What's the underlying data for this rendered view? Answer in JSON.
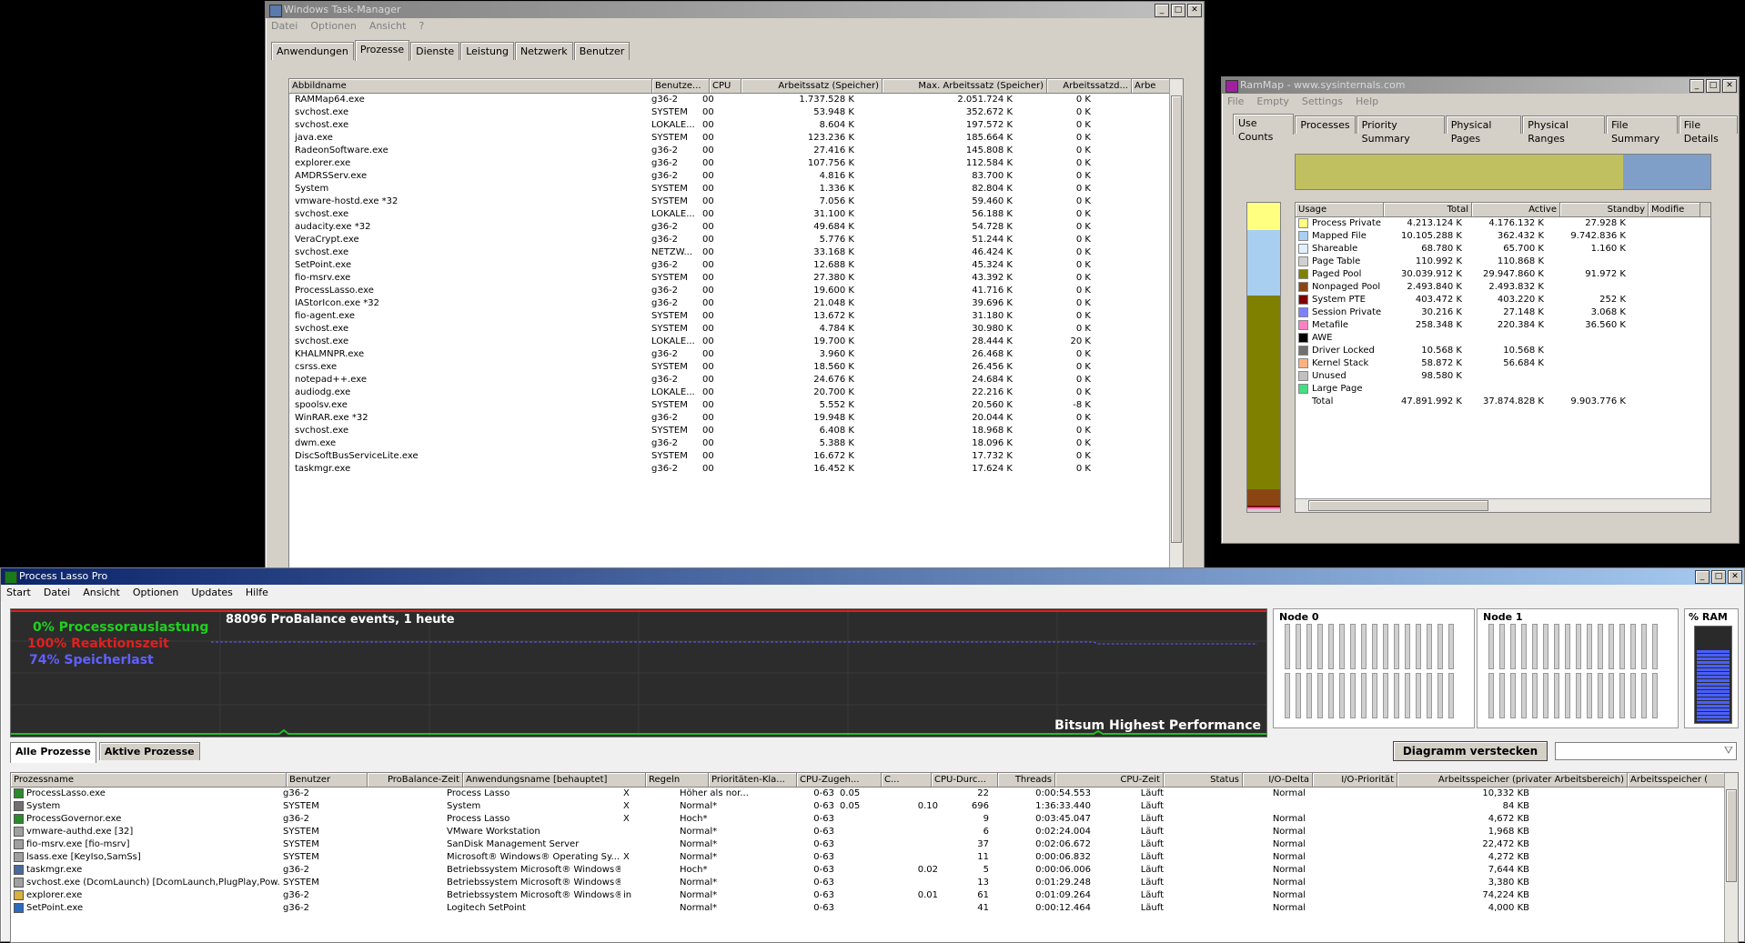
{
  "taskmgr": {
    "title": "Windows Task-Manager",
    "menu": [
      "Datei",
      "Optionen",
      "Ansicht",
      "?"
    ],
    "tabs": [
      "Anwendungen",
      "Prozesse",
      "Dienste",
      "Leistung",
      "Netzwerk",
      "Benutzer"
    ],
    "active_tab": "Prozesse",
    "columns": [
      "Abbildname",
      "Benutze...",
      "CPU",
      "Arbeitssatz (Speicher)",
      "Max. Arbeitssatz (Speicher)",
      "Arbeitssatzd...",
      "Arbe"
    ],
    "rows": [
      [
        "RAMMap64.exe",
        "g36-2",
        "00",
        "1.737.528 K",
        "2.051.724 K",
        "0 K"
      ],
      [
        "svchost.exe",
        "SYSTEM",
        "00",
        "53.948 K",
        "352.672 K",
        "0 K"
      ],
      [
        "svchost.exe",
        "LOKALE...",
        "00",
        "8.604 K",
        "197.572 K",
        "0 K"
      ],
      [
        "java.exe",
        "SYSTEM",
        "00",
        "123.236 K",
        "185.664 K",
        "0 K"
      ],
      [
        "RadeonSoftware.exe",
        "g36-2",
        "00",
        "27.416 K",
        "145.808 K",
        "0 K"
      ],
      [
        "explorer.exe",
        "g36-2",
        "00",
        "107.756 K",
        "112.584 K",
        "0 K"
      ],
      [
        "AMDRSServ.exe",
        "g36-2",
        "00",
        "4.816 K",
        "83.700 K",
        "0 K"
      ],
      [
        "System",
        "SYSTEM",
        "00",
        "1.336 K",
        "82.804 K",
        "0 K"
      ],
      [
        "vmware-hostd.exe *32",
        "SYSTEM",
        "00",
        "7.056 K",
        "59.460 K",
        "0 K"
      ],
      [
        "svchost.exe",
        "LOKALE...",
        "00",
        "31.100 K",
        "56.188 K",
        "0 K"
      ],
      [
        "audacity.exe *32",
        "g36-2",
        "00",
        "49.684 K",
        "54.728 K",
        "0 K"
      ],
      [
        "VeraCrypt.exe",
        "g36-2",
        "00",
        "5.776 K",
        "51.244 K",
        "0 K"
      ],
      [
        "svchost.exe",
        "NETZW...",
        "00",
        "33.168 K",
        "46.424 K",
        "0 K"
      ],
      [
        "SetPoint.exe",
        "g36-2",
        "00",
        "12.688 K",
        "45.324 K",
        "0 K"
      ],
      [
        "fio-msrv.exe",
        "SYSTEM",
        "00",
        "27.380 K",
        "43.392 K",
        "0 K"
      ],
      [
        "ProcessLasso.exe",
        "g36-2",
        "00",
        "19.600 K",
        "41.716 K",
        "0 K"
      ],
      [
        "IAStorIcon.exe *32",
        "g36-2",
        "00",
        "21.048 K",
        "39.696 K",
        "0 K"
      ],
      [
        "fio-agent.exe",
        "SYSTEM",
        "00",
        "13.672 K",
        "31.180 K",
        "0 K"
      ],
      [
        "svchost.exe",
        "SYSTEM",
        "00",
        "4.784 K",
        "30.980 K",
        "0 K"
      ],
      [
        "svchost.exe",
        "LOKALE...",
        "00",
        "19.700 K",
        "28.444 K",
        "20 K"
      ],
      [
        "KHALMNPR.exe",
        "g36-2",
        "00",
        "3.960 K",
        "26.468 K",
        "0 K"
      ],
      [
        "csrss.exe",
        "SYSTEM",
        "00",
        "18.560 K",
        "26.456 K",
        "0 K"
      ],
      [
        "notepad++.exe",
        "g36-2",
        "00",
        "24.676 K",
        "24.684 K",
        "0 K"
      ],
      [
        "audiodg.exe",
        "LOKALE...",
        "00",
        "20.700 K",
        "22.216 K",
        "0 K"
      ],
      [
        "spoolsv.exe",
        "SYSTEM",
        "00",
        "5.552 K",
        "20.560 K",
        "-8 K"
      ],
      [
        "WinRAR.exe *32",
        "g36-2",
        "00",
        "19.948 K",
        "20.044 K",
        "0 K"
      ],
      [
        "svchost.exe",
        "SYSTEM",
        "00",
        "6.408 K",
        "18.968 K",
        "0 K"
      ],
      [
        "dwm.exe",
        "g36-2",
        "00",
        "5.388 K",
        "18.096 K",
        "0 K"
      ],
      [
        "DiscSoftBusServiceLite.exe",
        "SYSTEM",
        "00",
        "16.672 K",
        "17.732 K",
        "0 K"
      ],
      [
        "taskmgr.exe",
        "g36-2",
        "00",
        "16.452 K",
        "17.624 K",
        "0 K"
      ]
    ]
  },
  "rammap": {
    "title": "RamMap - www.sysinternals.com",
    "menu": [
      "File",
      "Empty",
      "Settings",
      "Help"
    ],
    "tabs": [
      "Use Counts",
      "Processes",
      "Priority Summary",
      "Physical Pages",
      "Physical Ranges",
      "File Summary",
      "File Details"
    ],
    "active_tab": "Use Counts",
    "columns": [
      "Usage",
      "Total",
      "Active",
      "Standby",
      "Modifie"
    ],
    "rows": [
      {
        "usage": "Process Private",
        "color": "#ffff80",
        "total": "4.213.124 K",
        "active": "4.176.132 K",
        "standby": "27.928 K"
      },
      {
        "usage": "Mapped File",
        "color": "#a8cff0",
        "total": "10.105.288 K",
        "active": "362.432 K",
        "standby": "9.742.836 K"
      },
      {
        "usage": "Shareable",
        "color": "#e0f0ff",
        "total": "68.780 K",
        "active": "65.700 K",
        "standby": "1.160 K"
      },
      {
        "usage": "Page Table",
        "color": "#d0d0d0",
        "total": "110.992 K",
        "active": "110.868 K",
        "standby": ""
      },
      {
        "usage": "Paged Pool",
        "color": "#808000",
        "total": "30.039.912 K",
        "active": "29.947.860 K",
        "standby": "91.972 K"
      },
      {
        "usage": "Nonpaged Pool",
        "color": "#8b4513",
        "total": "2.493.840 K",
        "active": "2.493.832 K",
        "standby": ""
      },
      {
        "usage": "System PTE",
        "color": "#800000",
        "total": "403.472 K",
        "active": "403.220 K",
        "standby": "252 K"
      },
      {
        "usage": "Session Private",
        "color": "#8080ff",
        "total": "30.216 K",
        "active": "27.148 K",
        "standby": "3.068 K"
      },
      {
        "usage": "Metafile",
        "color": "#ff80c0",
        "total": "258.348 K",
        "active": "220.384 K",
        "standby": "36.560 K"
      },
      {
        "usage": "AWE",
        "color": "#000000",
        "total": "",
        "active": "",
        "standby": ""
      },
      {
        "usage": "Driver Locked",
        "color": "#707070",
        "total": "10.568 K",
        "active": "10.568 K",
        "standby": ""
      },
      {
        "usage": "Kernel Stack",
        "color": "#ffb080",
        "total": "58.872 K",
        "active": "56.684 K",
        "standby": ""
      },
      {
        "usage": "Unused",
        "color": "#c0c0c0",
        "total": "98.580 K",
        "active": "",
        "standby": ""
      },
      {
        "usage": "Large Page",
        "color": "#40e080",
        "total": "",
        "active": "",
        "standby": ""
      },
      {
        "usage": "Total",
        "color": "",
        "total": "47.891.992 K",
        "active": "37.874.828 K",
        "standby": "9.903.776 K"
      }
    ],
    "overview_bar": {
      "active_fraction": 0.79,
      "active_color": "#c0c060",
      "standby_color": "#7f9fc8"
    },
    "vertical_bar": [
      {
        "color": "#ffff80",
        "fraction": 0.088
      },
      {
        "color": "#a8cff0",
        "fraction": 0.211
      },
      {
        "color": "#808000",
        "fraction": 0.627
      },
      {
        "color": "#8b4513",
        "fraction": 0.052
      },
      {
        "color": "#800000",
        "fraction": 0.008
      },
      {
        "color": "#ff80c0",
        "fraction": 0.005
      }
    ]
  },
  "lasso": {
    "title": "Process Lasso Pro",
    "menu": [
      "Start",
      "Datei",
      "Ansicht",
      "Optionen",
      "Updates",
      "Hilfe"
    ],
    "stats": {
      "cpu": "0% Processorauslastung",
      "responsiveness": "100% Reaktionszeit",
      "memory": "74% Speicherlast"
    },
    "events": "88096 ProBalance events, 1 heute",
    "power_plan": "Bitsum Highest Performance",
    "node0": "Node 0",
    "node1": "Node 1",
    "ram_label": "% RAM",
    "ram_fraction": 0.74,
    "tabs": [
      "Alle Prozesse",
      "Aktive Prozesse"
    ],
    "active_tab": "Alle Prozesse",
    "hide_chart_button": "Diagramm verstecken",
    "columns": [
      "Prozessname",
      "Benutzer",
      "ProBalance-Zeit",
      "Anwendungsname [behauptet]",
      "Regeln",
      "Prioritäten-Kla...",
      "CPU-Zugeh...",
      "C...",
      "CPU-Durc...",
      "Threads",
      "CPU-Zeit",
      "Status",
      "I/O-Delta",
      "I/O-Priorität",
      "Arbeitsspeicher (privater Arbeitsbereich)",
      "Arbeitsspeicher ("
    ],
    "rows": [
      [
        "ProcessLasso.exe",
        "g36-2",
        "",
        "Process Lasso",
        "X",
        "Höher als nor...",
        "0-63",
        "0.05",
        "",
        "22",
        "0:00:54.553",
        "Läuft",
        "",
        "Normal",
        "10,332 KB"
      ],
      [
        "System",
        "SYSTEM",
        "",
        "System",
        "X",
        "Normal*",
        "0-63",
        "0.05",
        "0.10",
        "696",
        "1:36:33.440",
        "Läuft",
        "",
        "",
        "84 KB"
      ],
      [
        "ProcessGovernor.exe",
        "g36-2",
        "",
        "Process Lasso",
        "X",
        "Hoch*",
        "0-63",
        "",
        "",
        "9",
        "0:03:45.047",
        "Läuft",
        "",
        "Normal",
        "4,672 KB"
      ],
      [
        "vmware-authd.exe [32]",
        "SYSTEM",
        "",
        "VMware Workstation",
        "",
        "Normal*",
        "0-63",
        "",
        "",
        "6",
        "0:02:24.004",
        "Läuft",
        "",
        "Normal",
        "1,968 KB"
      ],
      [
        "fio-msrv.exe [fio-msrv]",
        "SYSTEM",
        "",
        "SanDisk Management Server",
        "",
        "Normal*",
        "0-63",
        "",
        "",
        "37",
        "0:02:06.672",
        "Läuft",
        "",
        "Normal",
        "22,472 KB"
      ],
      [
        "lsass.exe [KeyIso,SamSs]",
        "SYSTEM",
        "",
        "Microsoft® Windows® Operating Sy...",
        "X",
        "Normal*",
        "0-63",
        "",
        "",
        "11",
        "0:00:06.832",
        "Läuft",
        "",
        "Normal",
        "4,272 KB"
      ],
      [
        "taskmgr.exe",
        "g36-2",
        "",
        "Betriebssystem Microsoft® Windows®",
        "",
        "Hoch*",
        "0-63",
        "",
        "0.02",
        "5",
        "0:00:06.006",
        "Läuft",
        "",
        "Normal",
        "7,644 KB"
      ],
      [
        "svchost.exe (DcomLaunch) [DcomLaunch,PlugPlay,Pow...",
        "SYSTEM",
        "",
        "Betriebssystem Microsoft® Windows®",
        "",
        "Normal*",
        "0-63",
        "",
        "",
        "13",
        "0:01:29.248",
        "Läuft",
        "",
        "Normal",
        "3,380 KB"
      ],
      [
        "explorer.exe",
        "g36-2",
        "",
        "Betriebssystem Microsoft® Windows®",
        "in",
        "Normal*",
        "0-63",
        "",
        "0.01",
        "61",
        "0:01:09.264",
        "Läuft",
        "",
        "Normal",
        "74,224 KB"
      ],
      [
        "SetPoint.exe",
        "g36-2",
        "",
        "Logitech SetPoint",
        "",
        "Normal*",
        "0-63",
        "",
        "",
        "41",
        "0:00:12.464",
        "Läuft",
        "",
        "Normal",
        "4,000 KB"
      ]
    ]
  }
}
